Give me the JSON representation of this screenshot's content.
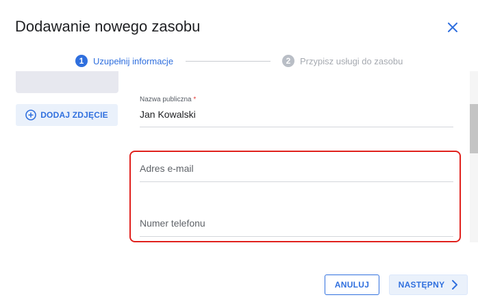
{
  "dialog": {
    "title": "Dodawanie nowego zasobu"
  },
  "stepper": {
    "steps": [
      {
        "number": "1",
        "label": "Uzupełnij informacje",
        "active": true
      },
      {
        "number": "2",
        "label": "Przypisz usługi do zasobu",
        "active": false
      }
    ]
  },
  "photo": {
    "add_label": "DODAJ ZDJĘCIE"
  },
  "form": {
    "public_name": {
      "label": "Nazwa publiczna",
      "required_mark": "*",
      "value": "Jan Kowalski"
    },
    "email": {
      "placeholder": "Adres e-mail"
    },
    "phone": {
      "placeholder": "Numer telefonu"
    }
  },
  "footer": {
    "cancel_label": "ANULUJ",
    "next_label": "NASTĘPNY"
  },
  "colors": {
    "accent": "#2f6fde",
    "highlight": "#e0201c",
    "inactive_step": "#b9bec6"
  }
}
